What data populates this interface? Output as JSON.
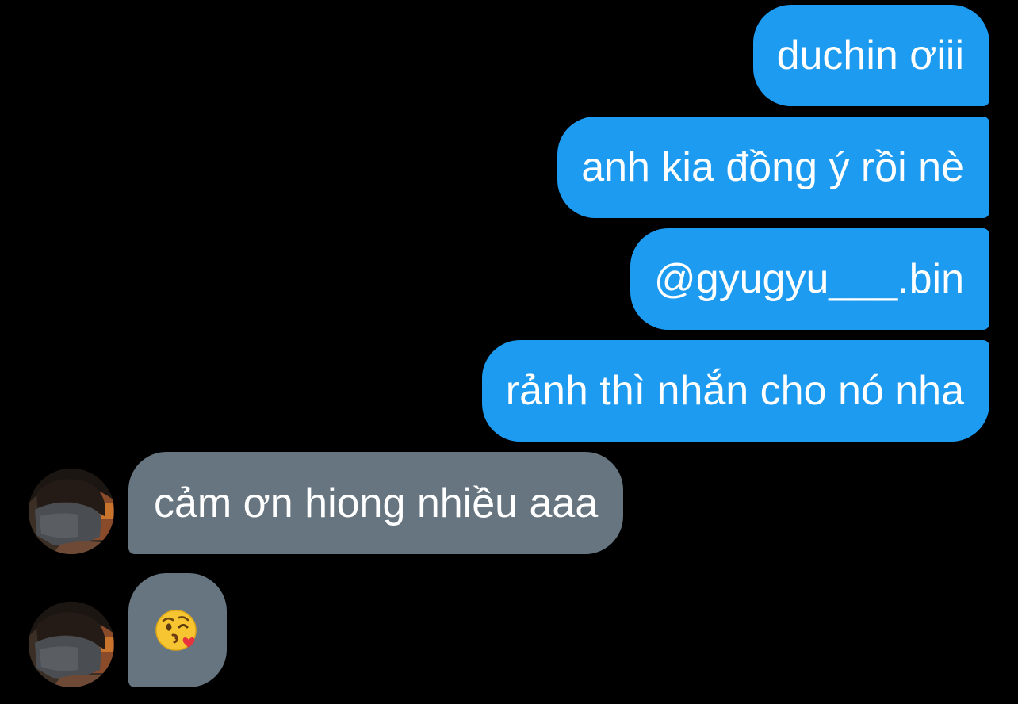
{
  "conversation": {
    "outgoing_messages": [
      {
        "text": "duchin ơiii"
      },
      {
        "text": "anh kia đồng ý rồi nè"
      },
      {
        "text": "@gyugyu___.bin"
      },
      {
        "text": "rảnh thì nhắn cho nó nha"
      }
    ],
    "incoming_messages": [
      {
        "text": "cảm ơn hiong nhiều aaa"
      },
      {
        "text": "😘",
        "emoji_name": "face-blowing-a-kiss"
      }
    ]
  },
  "colors": {
    "background": "#000000",
    "outgoing_bubble": "#1d9bf0",
    "incoming_bubble": "#66757f",
    "text": "#ffffff"
  }
}
